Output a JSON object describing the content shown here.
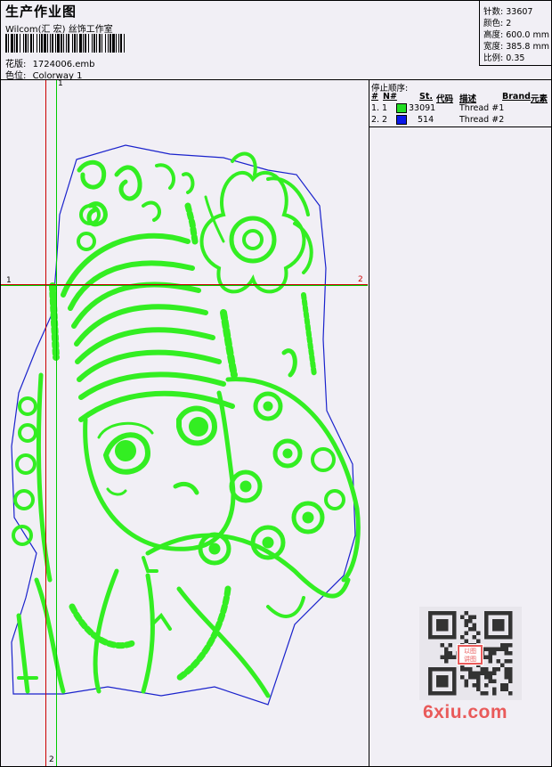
{
  "header": {
    "title": "生产作业图",
    "company": "Wilcom(汇 宏) 丝饰工作室",
    "design_label": "花版:",
    "design_value": "1724006.emb",
    "colorway_label": "色位:",
    "colorway_value": "Colorway 1"
  },
  "stats": [
    {
      "label": "针数",
      "value": "33607"
    },
    {
      "label": "颜色",
      "value": "2"
    },
    {
      "label": "高度",
      "value": "600.0 mm"
    },
    {
      "label": "宽度",
      "value": "385.8 mm"
    },
    {
      "label": "比例",
      "value": "0.35"
    }
  ],
  "stop_sequence": {
    "title": "停止顺序:",
    "headers": {
      "num": "#",
      "needle": "N#",
      "st": "St.",
      "code": "代码",
      "desc": "描述",
      "brand": "Brand",
      "element": "元素"
    },
    "rows": [
      {
        "index": "1.",
        "needle": "1",
        "color": "#22dd22",
        "stitches": "33091",
        "desc": "Thread #1"
      },
      {
        "index": "2.",
        "needle": "2",
        "color": "#0a18e8",
        "stitches": "514",
        "desc": "Thread #2"
      }
    ]
  },
  "guides": {
    "h_left": "1",
    "h_right": "2",
    "v_top": "1",
    "v_bottom": "2"
  },
  "colors": {
    "stitch_green": "#33ee22",
    "outline_blue": "#1a22cc",
    "guide_red": "#cc0000",
    "watermark": "#e95a5a"
  },
  "watermark": {
    "text": "6xiu.com",
    "seal": "以图 讲图"
  }
}
